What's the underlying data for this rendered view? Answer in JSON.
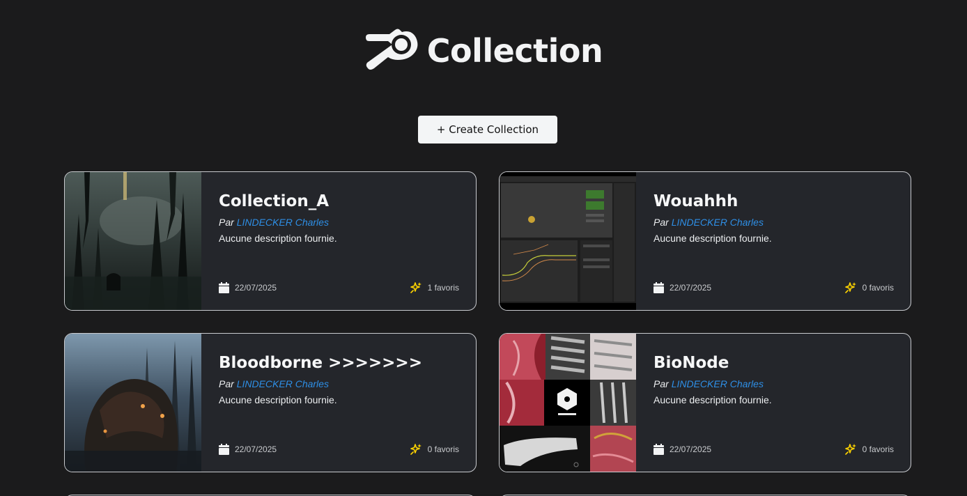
{
  "header": {
    "title": "Collection",
    "logo_icon": "blender-logo-icon"
  },
  "toolbar": {
    "create_label": "+ Create Collection"
  },
  "collections": [
    {
      "title": "Collection_A",
      "by_label": "Par",
      "author": "LINDECKER Charles",
      "description": "Aucune description fournie.",
      "date": "22/07/2025",
      "favorites": "1 favoris",
      "thumbnail": "dark-gothic-forest-image"
    },
    {
      "title": "Wouahhh",
      "by_label": "Par",
      "author": "LINDECKER Charles",
      "description": "Aucune description fournie.",
      "date": "22/07/2025",
      "favorites": "0 favoris",
      "thumbnail": "blender-graph-editor-screenshot"
    },
    {
      "title": "Bloodborne >>>>>>>",
      "by_label": "Par",
      "author": "LINDECKER Charles",
      "description": "Aucune description fournie.",
      "date": "22/07/2025",
      "favorites": "0 favoris",
      "thumbnail": "bloodborne-beast-artwork"
    },
    {
      "title": "BioNode",
      "by_label": "Par",
      "author": "LINDECKER Charles",
      "description": "Aucune description fournie.",
      "date": "22/07/2025",
      "favorites": "0 favoris",
      "thumbnail": "bioxel-medical-scan-collage"
    }
  ],
  "colors": {
    "background": "#1b1b1c",
    "card": "#24262b",
    "link": "#2e8fe6",
    "favorite_icon": "#ffd400",
    "button": "#f3f5f6"
  }
}
